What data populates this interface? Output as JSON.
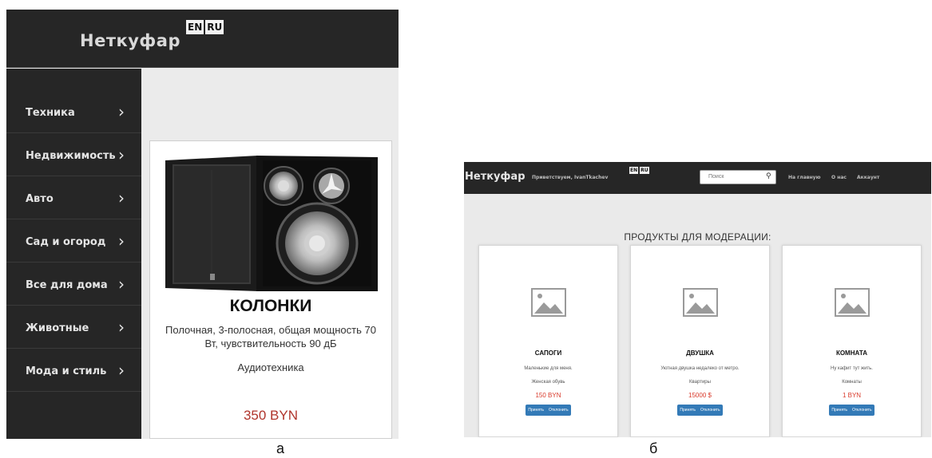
{
  "panel_a": {
    "logo": "Неткуфар",
    "lang": [
      "EN",
      "RU"
    ],
    "sidebar": [
      {
        "label": "Техника"
      },
      {
        "label": "Недвижимость"
      },
      {
        "label": "Авто"
      },
      {
        "label": "Сад и огород"
      },
      {
        "label": "Все для дома"
      },
      {
        "label": "Животные"
      },
      {
        "label": "Мода и стиль"
      }
    ],
    "chevron": "›",
    "product": {
      "title": "КОЛОНКИ",
      "description": "Полочная, 3-полосная, общая мощность 70 Вт, чувствительность 90 дБ",
      "category": "Аудиотехника",
      "price": "350 BYN"
    },
    "caption": "а"
  },
  "panel_b": {
    "logo": "Неткуфар",
    "greeting": "Приветствуем, IvanTkachev",
    "lang": [
      "EN",
      "RU"
    ],
    "search_placeholder": "Поиск",
    "nav": [
      "На главную",
      "О нас",
      "Аккаунт"
    ],
    "heading": "ПРОДУКТЫ ДЛЯ МОДЕРАЦИИ:",
    "cards": [
      {
        "title": "САПОГИ",
        "description": "Маленькие для меня.",
        "category": "Женская обувь",
        "price": "150 BYN",
        "accept": "Принять",
        "reject": "Отклонить"
      },
      {
        "title": "ДВУШКА",
        "description": "Уютная двушка недалеко от метро.",
        "category": "Квартиры",
        "price": "15000 $",
        "accept": "Принять",
        "reject": "Отклонить"
      },
      {
        "title": "КОМНАТА",
        "description": "Ну кафит тут жить.",
        "category": "Комнаты",
        "price": "1 BYN",
        "accept": "Принять",
        "reject": "Отклонить"
      }
    ],
    "caption": "б"
  },
  "colors": {
    "header_bg": "#262626",
    "page_bg": "#ebebeb",
    "price_red": "#b0352c",
    "button_blue": "#337ab7"
  }
}
